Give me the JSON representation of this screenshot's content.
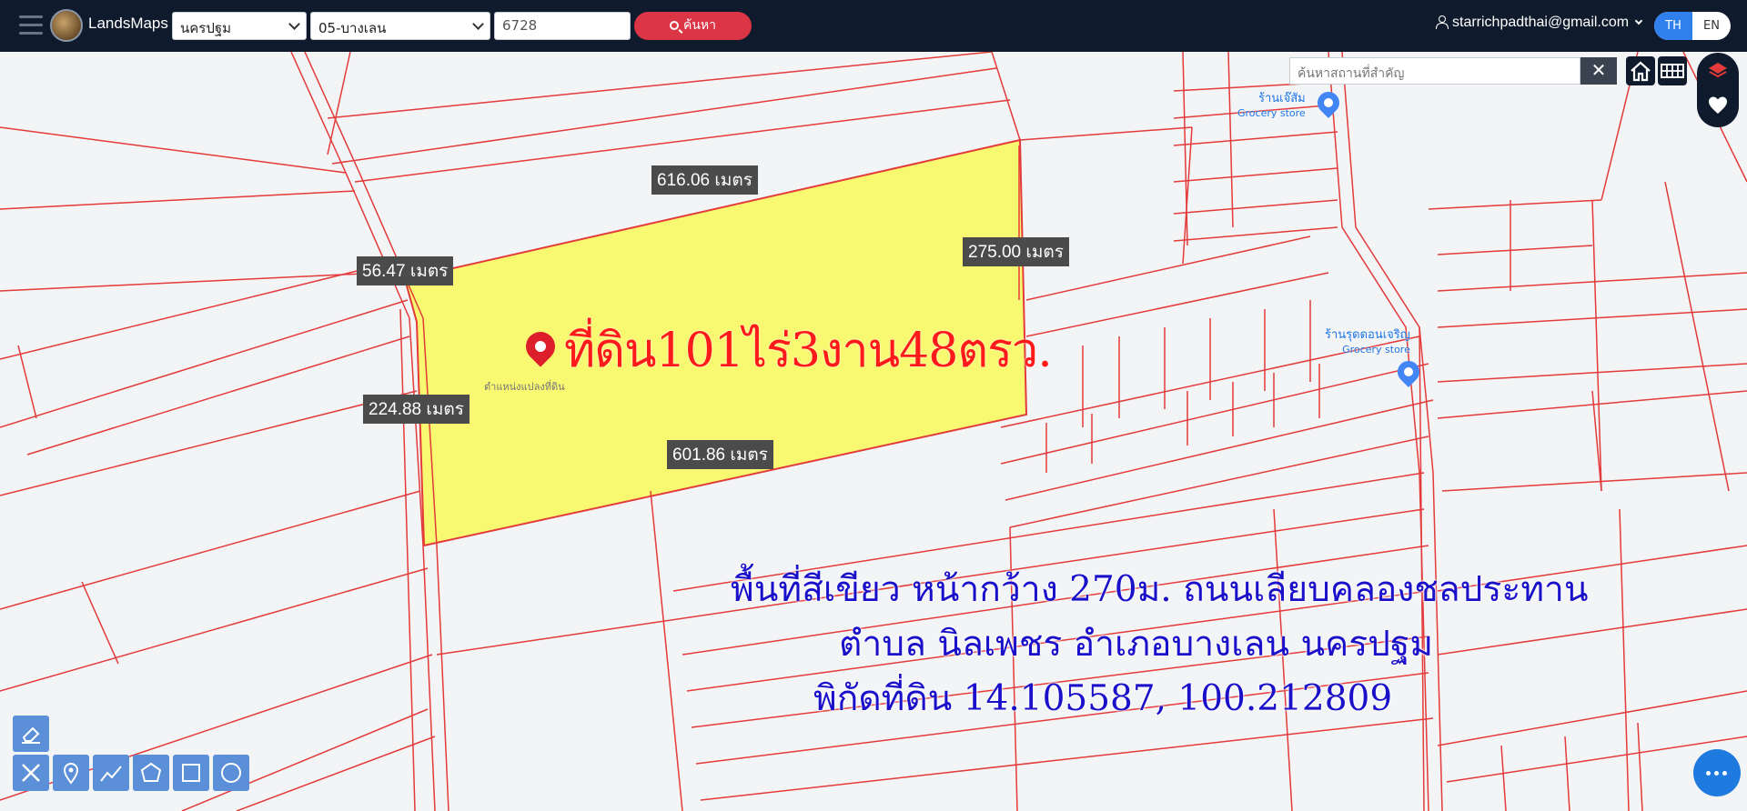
{
  "header": {
    "brand": "LandsMaps",
    "province_select": "นครปฐม",
    "amphoe_select": "05-บางเลน",
    "parcel_input": "6728",
    "search_button": "ค้นหา",
    "user_email": "starrichpadthai@gmail.com",
    "lang_th": "TH",
    "lang_en": "EN"
  },
  "map": {
    "place_search_placeholder": "ค้นหาสถานที่สำคัญ",
    "place_clear": "✕",
    "dimensions": {
      "top": "616.06 เมตร",
      "right": "275.00 เมตร",
      "top_left": "56.47 เมตร",
      "left": "224.88 เมตร",
      "bottom": "601.86 เมตร"
    },
    "parcel_title": "ที่ดิน101ไร่3งาน48ตรว.",
    "parcel_location_label": "ตำแหน่งแปลงที่ดิน",
    "overlay_lines": [
      "พื้นที่สีเขียว หน้ากว้าง 270ม. ถนนเลียบคลองชลประทาน",
      "ตำบล นิลเพชร อำเภอบางเลน นครปฐม",
      "พิกัดที่ดิน 14.105587, 100.212809"
    ],
    "pois": [
      {
        "name": "ร้านเจ๊สัม",
        "category": "Grocery store"
      },
      {
        "name": "ร้านรุดดอนเจริญ",
        "category": "Grocery store"
      }
    ]
  },
  "colors": {
    "topbar": "#0f1b2d",
    "parcel_fill": "#f9f871",
    "boundary": "#e33a3a",
    "search_button": "#dc3545",
    "overlay_text": "#1a10c9",
    "parcel_title": "#ff1a1a"
  }
}
